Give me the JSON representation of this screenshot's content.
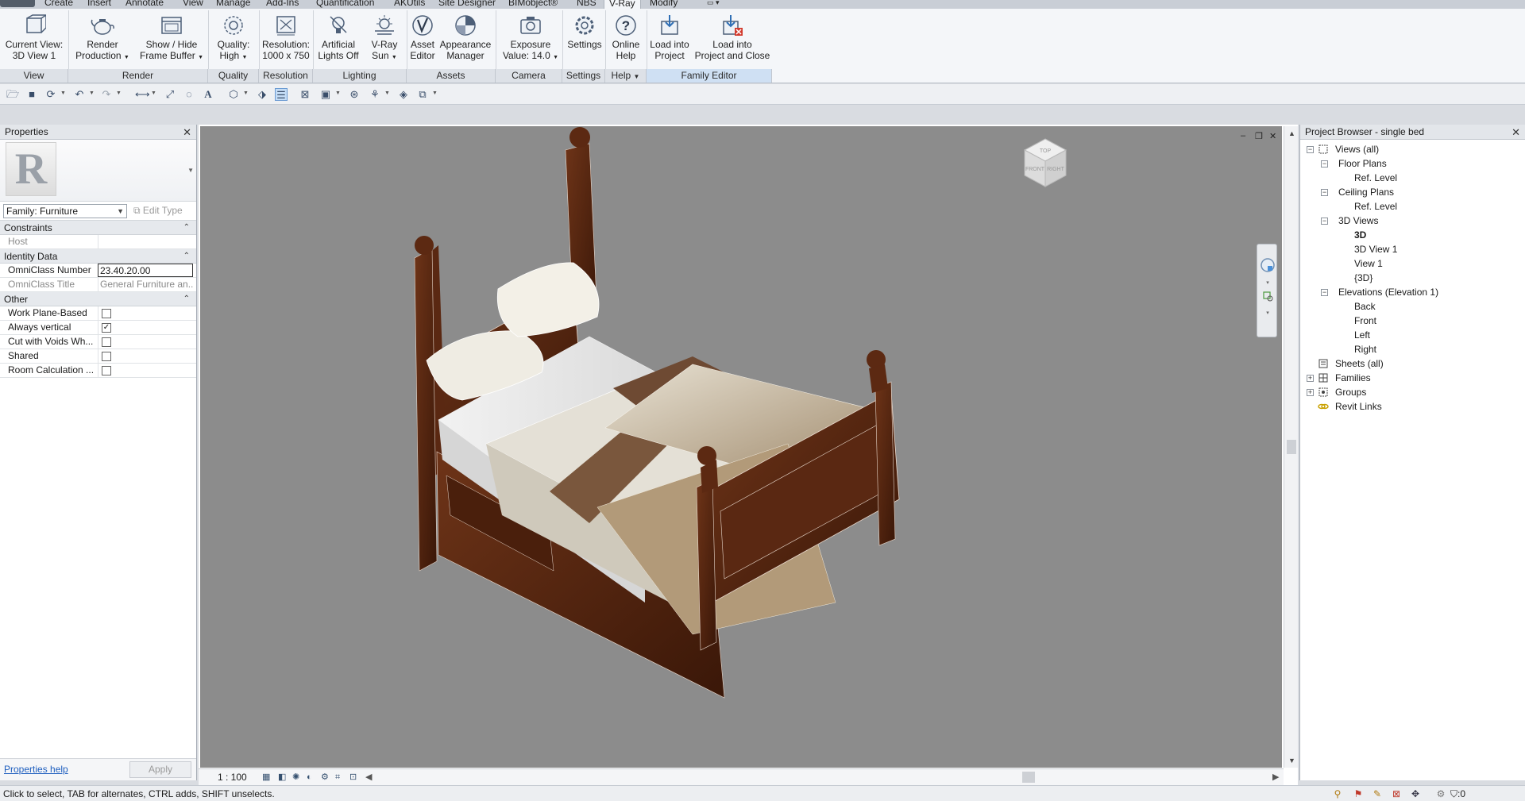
{
  "ribbon_tabs": [
    "Create",
    "Insert",
    "Annotate",
    "View",
    "Manage",
    "Add-Ins",
    "Quantification",
    "AKUtils",
    "Site Designer",
    "BIMobject®",
    "NBS",
    "V-Ray",
    "Modify"
  ],
  "active_tab": "V-Ray",
  "ribbon": {
    "current_view": [
      "Current View:",
      "3D View 1"
    ],
    "render": [
      "Render",
      "Production"
    ],
    "frame_buffer": [
      "Show / Hide",
      "Frame Buffer"
    ],
    "quality": [
      "Quality:",
      "High"
    ],
    "resolution": [
      "Resolution:",
      "1000 x 750"
    ],
    "artificial_lights": [
      "Artificial",
      "Lights Off"
    ],
    "vray_sun": [
      "V-Ray",
      "Sun"
    ],
    "asset_editor": [
      "Asset",
      "Editor"
    ],
    "appearance_manager": [
      "Appearance",
      "Manager"
    ],
    "exposure": [
      "Exposure",
      "Value: 14.0"
    ],
    "settings": [
      "Settings"
    ],
    "online_help": [
      "Online",
      "Help"
    ],
    "load_into_project": [
      "Load into",
      "Project"
    ],
    "load_and_close": [
      "Load into",
      "Project and Close"
    ],
    "panels": [
      "View",
      "Render",
      "Quality",
      "Resolution",
      "Lighting",
      "Assets",
      "Camera",
      "Settings",
      "Help",
      "Family Editor"
    ]
  },
  "properties": {
    "title": "Properties",
    "family_select": "Family: Furniture",
    "edit_type": "Edit Type",
    "sections": {
      "constraints": "Constraints",
      "identity": "Identity Data",
      "other": "Other"
    },
    "host": {
      "label": "Host",
      "value": ""
    },
    "omniclass_number": {
      "label": "OmniClass Number",
      "value": "23.40.20.00"
    },
    "omniclass_title": {
      "label": "OmniClass Title",
      "value": "General Furniture an..."
    },
    "other_rows": [
      {
        "label": "Work Plane-Based",
        "checked": false
      },
      {
        "label": "Always vertical",
        "checked": true
      },
      {
        "label": "Cut with Voids Wh...",
        "checked": false
      },
      {
        "label": "Shared",
        "checked": false
      },
      {
        "label": "Room Calculation ...",
        "checked": false
      }
    ],
    "help_link": "Properties help",
    "apply": "Apply"
  },
  "viewport": {
    "scale": "1 : 100",
    "viewcube_faces": {
      "top": "TOP",
      "front": "FRONT",
      "right": "RIGHT"
    }
  },
  "browser": {
    "title": "Project Browser - single bed",
    "views_all": "Views (all)",
    "floor_plans": "Floor Plans",
    "floor_ref": "Ref. Level",
    "ceiling_plans": "Ceiling Plans",
    "ceiling_ref": "Ref. Level",
    "views_3d": "3D Views",
    "v3d": "3D",
    "v3d1": "3D View 1",
    "view1": "View 1",
    "v3dp": "{3D}",
    "elevations": "Elevations (Elevation 1)",
    "back": "Back",
    "front": "Front",
    "left": "Left",
    "right": "Right",
    "sheets": "Sheets (all)",
    "families": "Families",
    "groups": "Groups",
    "revit_links": "Revit Links"
  },
  "status": {
    "message": "Click to select, TAB for alternates, CTRL adds, SHIFT unselects.",
    "filter_count": ":0"
  }
}
